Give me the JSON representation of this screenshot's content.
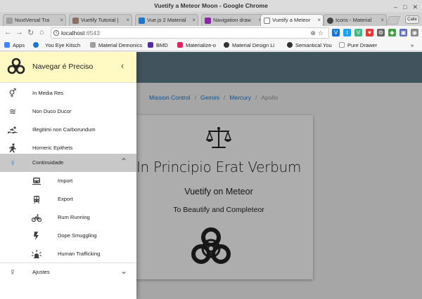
{
  "window": {
    "title": "Vuetify a Meteor Moon - Google Chrome",
    "controls": [
      "–",
      "□",
      "✕"
    ]
  },
  "tabs": [
    {
      "label": "NuxtVersal Tra",
      "color": "#9e9e9e"
    },
    {
      "label": "Vuetify Tutorial |",
      "color": "#8d6e63"
    },
    {
      "label": "Vue.js 2 Material",
      "color": "#1976d2"
    },
    {
      "label": "Navigation draw",
      "color": "#8e24aa"
    },
    {
      "label": "Vuetify a Meteor",
      "color": "#ffffff",
      "active": true
    },
    {
      "label": "Icons - Material",
      "color": "#424242"
    }
  ],
  "profile": "Calle",
  "address": {
    "host": "localhost",
    "port": ":6543"
  },
  "bookmarks": [
    {
      "label": "Apps",
      "color": "#4285f4"
    },
    {
      "label": "",
      "color": "#1976d2"
    },
    {
      "label": "You Eye Kitsch",
      "color": "#555555"
    },
    {
      "label": "Material Demonics",
      "color": "#9e9e9e"
    },
    {
      "label": "BMD",
      "color": "#512da8"
    },
    {
      "label": "Materialize-o",
      "color": "#e91e63"
    },
    {
      "label": "Material Design Li",
      "color": "#333333"
    },
    {
      "label": "Semantical You",
      "color": "#333333"
    },
    {
      "label": "Pure Drawer",
      "color": "#9e9e9e"
    }
  ],
  "breadcrumbs": [
    "Mission Control",
    "Gemini",
    "Mercury",
    "Apollo"
  ],
  "card": {
    "title": "In Principio Erat Verbum",
    "subtitle": "Vuetify on Meteor",
    "tagline": "To Beautify and Completeor"
  },
  "drawer": {
    "title": "Navegar é Preciso",
    "items": [
      {
        "label": "In Media Res",
        "icon": "gender-icon"
      },
      {
        "label": "Non Duco Ducor",
        "icon": "waves-icon"
      },
      {
        "label": "Illegitimi non Carborundum",
        "icon": "swim-icon"
      },
      {
        "label": "Homeric Epithets",
        "icon": "run-icon"
      }
    ],
    "group": {
      "label": "Continuidade",
      "icon": "female-icon"
    },
    "subitems": [
      {
        "label": "Import",
        "icon": "train-icon"
      },
      {
        "label": "Export",
        "icon": "tram-icon"
      },
      {
        "label": "Rum Running",
        "icon": "bike-icon"
      },
      {
        "label": "Dope Smuggling",
        "icon": "flash-icon"
      },
      {
        "label": "Human Trafficking",
        "icon": "alarm-light-icon"
      }
    ],
    "settings": {
      "label": "Ajustes",
      "icon": "mercury-icon"
    }
  },
  "colors": {
    "toolbar": "#607d8b",
    "drawer_header": "#fff9c4",
    "link": "#1976d2",
    "group_active": "#c8c8c8"
  }
}
